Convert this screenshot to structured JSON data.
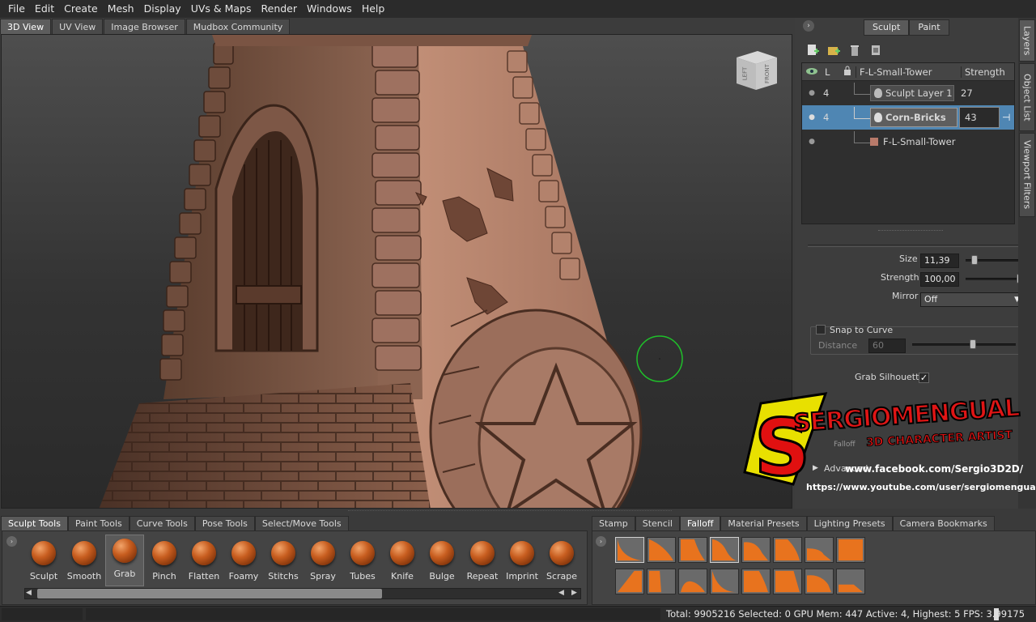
{
  "menu": [
    "File",
    "Edit",
    "Create",
    "Mesh",
    "Display",
    "UVs & Maps",
    "Render",
    "Windows",
    "Help"
  ],
  "view_tabs": [
    "3D View",
    "UV View",
    "Image Browser",
    "Mudbox Community"
  ],
  "view_cube": {
    "left": "LEFT",
    "front": "FRONT"
  },
  "right_panel": {
    "mode_tabs": [
      "Sculpt",
      "Paint"
    ],
    "side_tabs": [
      "Layers",
      "Object List",
      "Viewport Filters"
    ],
    "layers": {
      "header": {
        "l": "L",
        "object": "F-L-Small-Tower",
        "strength": "Strength"
      },
      "rows": [
        {
          "level": "4",
          "name": "Sculpt Layer 1",
          "strength": "27"
        },
        {
          "level": "4",
          "name": "Corn-Bricks",
          "strength": "43",
          "selected": true
        },
        {
          "level": "",
          "name": "F-L-Small-Tower",
          "strength": ""
        }
      ]
    },
    "properties": {
      "size_label": "Size",
      "size_value": "11,39",
      "strength_label": "Strength",
      "strength_value": "100,00",
      "mirror_label": "Mirror",
      "mirror_value": "Off",
      "snap_label": "Snap to Curve",
      "distance_label": "Distance",
      "distance_value": "60",
      "grab_silhouette_label": "Grab Silhouette",
      "falloff_label": "Falloff",
      "advanced_label": "Advanced"
    }
  },
  "watermark": {
    "name": "SERGIOMENGUAL",
    "subtitle": "3D CHARACTER ARTIST",
    "facebook": "www.facebook.com/Sergio3D2D/",
    "youtube": "https://www.youtube.com/user/sergiomengual"
  },
  "tool_tray": {
    "tabs": [
      "Sculpt Tools",
      "Paint Tools",
      "Curve Tools",
      "Pose Tools",
      "Select/Move Tools"
    ],
    "tools": [
      "Sculpt",
      "Smooth",
      "Grab",
      "Pinch",
      "Flatten",
      "Foamy",
      "Stitchs",
      "Spray",
      "Tubes",
      "Knife",
      "Bulge",
      "Repeat",
      "Imprint",
      "Scrape"
    ],
    "active_tool": "Grab"
  },
  "stamp_tray": {
    "tabs": [
      "Stamp",
      "Stencil",
      "Falloff",
      "Material Presets",
      "Lighting Presets",
      "Camera Bookmarks"
    ],
    "active_tab": "Falloff"
  },
  "status": "Total: 9905216  Selected: 0 GPU Mem: 447  Active: 4, Highest: 5  FPS: 3.99175",
  "colors": {
    "accent_orange": "#e8731e",
    "selection_blue": "#4f86b3",
    "cursor_green": "#1fbf2a"
  }
}
